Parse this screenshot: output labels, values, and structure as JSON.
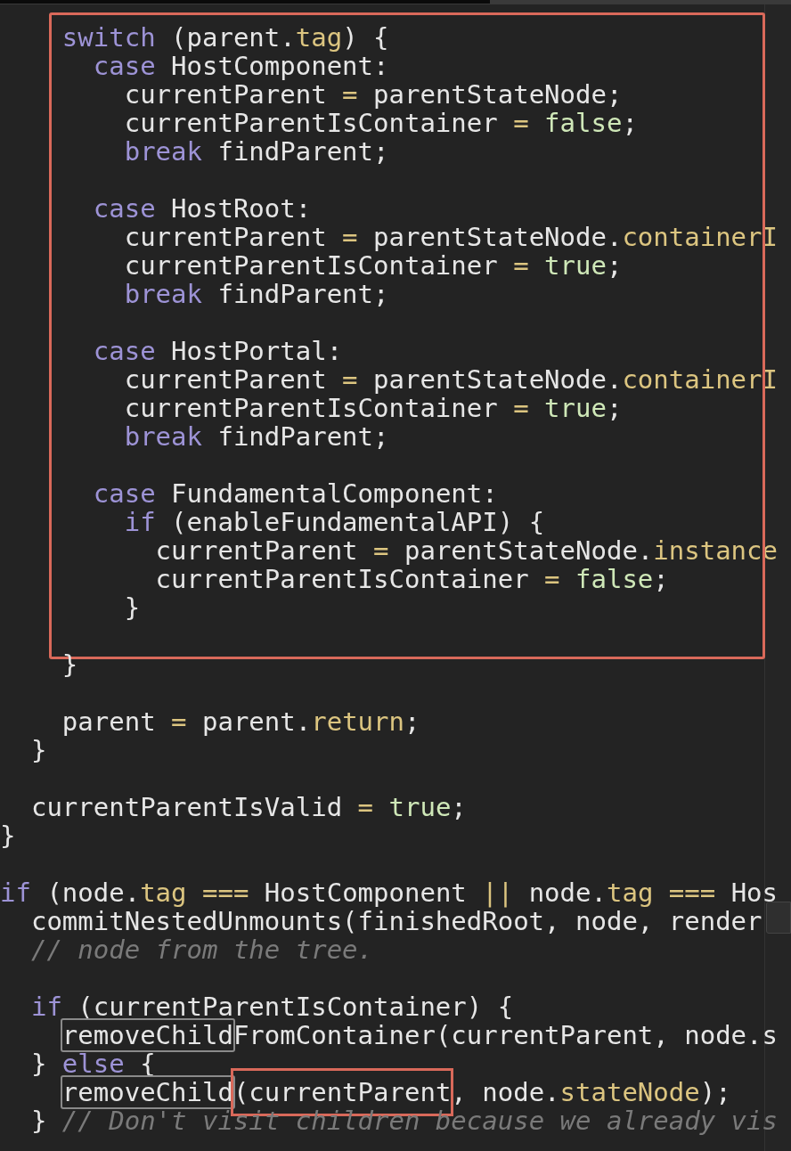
{
  "editor": {
    "blocks": [
      {
        "framed": true,
        "lines": [
          {
            "kind": "code",
            "tokens": [
              {
                "text": "    switch",
                "kind": "keyword"
              },
              {
                "text": " (parent.",
                "kind": "plain"
              },
              {
                "text": "tag",
                "kind": "property"
              },
              {
                "text": ") {",
                "kind": "plain"
              }
            ]
          },
          {
            "kind": "code",
            "tokens": [
              {
                "text": "      case",
                "kind": "keyword"
              },
              {
                "text": " HostComponent:",
                "kind": "plain"
              }
            ]
          },
          {
            "kind": "code",
            "tokens": [
              {
                "text": "        currentParent ",
                "kind": "plain"
              },
              {
                "text": "=",
                "kind": "operator"
              },
              {
                "text": " parentStateNode;",
                "kind": "plain"
              }
            ]
          },
          {
            "kind": "code",
            "tokens": [
              {
                "text": "        currentParentIsContainer ",
                "kind": "plain"
              },
              {
                "text": "=",
                "kind": "operator"
              },
              {
                "text": " false",
                "kind": "literal"
              },
              {
                "text": ";",
                "kind": "plain"
              }
            ]
          },
          {
            "kind": "code",
            "tokens": [
              {
                "text": "        break",
                "kind": "keyword"
              },
              {
                "text": " findParent;",
                "kind": "plain"
              }
            ]
          },
          {
            "kind": "blank"
          },
          {
            "kind": "code",
            "tokens": [
              {
                "text": "      case",
                "kind": "keyword"
              },
              {
                "text": " HostRoot:",
                "kind": "plain"
              }
            ]
          },
          {
            "kind": "code",
            "tokens": [
              {
                "text": "        currentParent ",
                "kind": "plain"
              },
              {
                "text": "=",
                "kind": "operator"
              },
              {
                "text": " parentStateNode.",
                "kind": "plain"
              },
              {
                "text": "containerI",
                "kind": "property"
              }
            ]
          },
          {
            "kind": "code",
            "tokens": [
              {
                "text": "        currentParentIsContainer ",
                "kind": "plain"
              },
              {
                "text": "=",
                "kind": "operator"
              },
              {
                "text": " true",
                "kind": "literal"
              },
              {
                "text": ";",
                "kind": "plain"
              }
            ]
          },
          {
            "kind": "code",
            "tokens": [
              {
                "text": "        break",
                "kind": "keyword"
              },
              {
                "text": " findParent;",
                "kind": "plain"
              }
            ]
          },
          {
            "kind": "blank"
          },
          {
            "kind": "code",
            "tokens": [
              {
                "text": "      case",
                "kind": "keyword"
              },
              {
                "text": " HostPortal:",
                "kind": "plain"
              }
            ]
          },
          {
            "kind": "code",
            "tokens": [
              {
                "text": "        currentParent ",
                "kind": "plain"
              },
              {
                "text": "=",
                "kind": "operator"
              },
              {
                "text": " parentStateNode.",
                "kind": "plain"
              },
              {
                "text": "containerI",
                "kind": "property"
              }
            ]
          },
          {
            "kind": "code",
            "tokens": [
              {
                "text": "        currentParentIsContainer ",
                "kind": "plain"
              },
              {
                "text": "=",
                "kind": "operator"
              },
              {
                "text": " true",
                "kind": "literal"
              },
              {
                "text": ";",
                "kind": "plain"
              }
            ]
          },
          {
            "kind": "code",
            "tokens": [
              {
                "text": "        break",
                "kind": "keyword"
              },
              {
                "text": " findParent;",
                "kind": "plain"
              }
            ]
          },
          {
            "kind": "blank"
          },
          {
            "kind": "code",
            "tokens": [
              {
                "text": "      case",
                "kind": "keyword"
              },
              {
                "text": " FundamentalComponent:",
                "kind": "plain"
              }
            ]
          },
          {
            "kind": "code",
            "tokens": [
              {
                "text": "        if",
                "kind": "keyword"
              },
              {
                "text": " (enableFundamentalAPI) {",
                "kind": "plain"
              }
            ]
          },
          {
            "kind": "code",
            "tokens": [
              {
                "text": "          currentParent ",
                "kind": "plain"
              },
              {
                "text": "=",
                "kind": "operator"
              },
              {
                "text": " parentStateNode.",
                "kind": "plain"
              },
              {
                "text": "instance",
                "kind": "property"
              }
            ]
          },
          {
            "kind": "code",
            "tokens": [
              {
                "text": "          currentParentIsContainer ",
                "kind": "plain"
              },
              {
                "text": "=",
                "kind": "operator"
              },
              {
                "text": " false",
                "kind": "literal"
              },
              {
                "text": ";",
                "kind": "plain"
              }
            ]
          },
          {
            "kind": "code",
            "tokens": [
              {
                "text": "        }",
                "kind": "plain"
              }
            ]
          },
          {
            "kind": "blank"
          }
        ]
      },
      {
        "framed": false,
        "lines": [
          {
            "kind": "code",
            "tokens": [
              {
                "text": "    }",
                "kind": "plain"
              }
            ]
          },
          {
            "kind": "blank"
          },
          {
            "kind": "code",
            "tokens": [
              {
                "text": "    parent ",
                "kind": "plain"
              },
              {
                "text": "=",
                "kind": "operator"
              },
              {
                "text": " parent.",
                "kind": "plain"
              },
              {
                "text": "return",
                "kind": "property"
              },
              {
                "text": ";",
                "kind": "plain"
              }
            ]
          },
          {
            "kind": "code",
            "tokens": [
              {
                "text": "  }",
                "kind": "plain"
              }
            ]
          },
          {
            "kind": "blank"
          },
          {
            "kind": "code",
            "tokens": [
              {
                "text": "  currentParentIsValid ",
                "kind": "plain"
              },
              {
                "text": "=",
                "kind": "operator"
              },
              {
                "text": " true",
                "kind": "literal"
              },
              {
                "text": ";",
                "kind": "plain"
              }
            ]
          },
          {
            "kind": "code",
            "tokens": [
              {
                "text": "}",
                "kind": "plain"
              }
            ]
          },
          {
            "kind": "blank"
          },
          {
            "kind": "code",
            "tokens": [
              {
                "text": "if",
                "kind": "keyword"
              },
              {
                "text": " (node.",
                "kind": "plain"
              },
              {
                "text": "tag",
                "kind": "property"
              },
              {
                "text": " ===",
                "kind": "operator"
              },
              {
                "text": " HostComponent ",
                "kind": "plain"
              },
              {
                "text": "||",
                "kind": "operator"
              },
              {
                "text": " node.",
                "kind": "plain"
              },
              {
                "text": "tag",
                "kind": "property"
              },
              {
                "text": " ===",
                "kind": "operator"
              },
              {
                "text": " Hos",
                "kind": "plain"
              }
            ]
          },
          {
            "kind": "code",
            "tokens": [
              {
                "text": "  commitNestedUnmounts(finishedRoot, node, render",
                "kind": "plain"
              }
            ]
          },
          {
            "kind": "code",
            "tokens": [
              {
                "text": "  // node from the tree.",
                "kind": "comment"
              }
            ]
          },
          {
            "kind": "blank"
          },
          {
            "kind": "code",
            "tokens": [
              {
                "text": "  if",
                "kind": "keyword"
              },
              {
                "text": " (currentParentIsContainer) {",
                "kind": "plain"
              }
            ]
          },
          {
            "kind": "code",
            "tokens": [
              {
                "text": "    removeChild",
                "kind": "match"
              },
              {
                "text": "FromContainer(currentParent, node.s",
                "kind": "plain"
              }
            ]
          },
          {
            "kind": "code",
            "tokens": [
              {
                "text": "  } ",
                "kind": "plain"
              },
              {
                "text": "else",
                "kind": "keyword"
              },
              {
                "text": " {",
                "kind": "plain"
              }
            ]
          },
          {
            "kind": "code",
            "tokens": [
              {
                "text": "    removeChild",
                "kind": "match"
              },
              {
                "text": "(currentParent",
                "kind": "marked"
              },
              {
                "text": ", node.",
                "kind": "plain"
              },
              {
                "text": "stateNode",
                "kind": "property"
              },
              {
                "text": ");",
                "kind": "plain"
              }
            ]
          },
          {
            "kind": "code",
            "tokens": [
              {
                "text": "  } ",
                "kind": "plain"
              },
              {
                "text": "// Don't visit children because we already vis",
                "kind": "comment"
              }
            ]
          }
        ]
      }
    ]
  }
}
